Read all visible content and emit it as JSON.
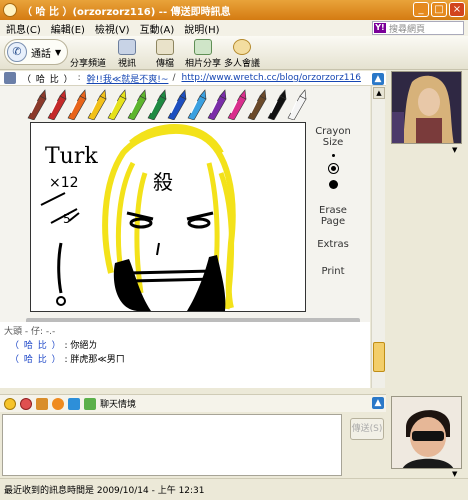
{
  "window": {
    "title": "（ 哈 比 ）(orzorzorz116) -- 傳送即時訊息",
    "min": "_",
    "max": "□",
    "close": "×"
  },
  "menu": {
    "items": [
      "訊息(C)",
      "編輯(E)",
      "檢視(V)",
      "互動(A)",
      "說明(H)"
    ]
  },
  "search": {
    "logo": "Y!",
    "placeholder": "搜尋網頁"
  },
  "toolbar": {
    "call_label": "通話",
    "share_label": "分享頻道",
    "video_label": "視訊",
    "file_label": "傳檔",
    "photo_label": "相片分享",
    "conference_label": "多人會議"
  },
  "address": {
    "name": "（ 哈 比 ）",
    "separator": ":",
    "status_link": "幹!!我≪就是不爽!~",
    "slash": "/",
    "blog_link": "http://www.wretch.cc/blog/orzorzorz116"
  },
  "side_tools": {
    "crayon_size_1": "Crayon",
    "crayon_size_2": "Size",
    "erase_1": "Erase",
    "erase_2": "Page",
    "extras": "Extras",
    "print": "Print"
  },
  "drawing": {
    "text_turk": "Turk",
    "text_x12": "×12",
    "text_kill": "殺",
    "text_5": "5"
  },
  "chat": {
    "header": "大頭 - 仔: -.-",
    "lines": [
      {
        "who": "（ 哈 比 ）",
        "msg": ": 你絕ㄌ"
      },
      {
        "who": "（ 哈 比 ）",
        "msg": ": 胖虎那≪男ㄇ"
      }
    ]
  },
  "emoticons": {
    "label": "聊天情境"
  },
  "input": {
    "send_label": "傳送(S)"
  },
  "status": {
    "text": "最近收到的訊息時間是 2009/10/14 - 上午 12:31"
  },
  "colors": {
    "title_orange": "#d47b12",
    "link_blue": "#1747b3",
    "crayons": [
      "#8b3a2b",
      "#c42a2a",
      "#e8641b",
      "#f2c118",
      "#e6e21a",
      "#5db52e",
      "#1f8a43",
      "#1d4fbf",
      "#3aa0e0",
      "#7a2ea8",
      "#d92f8c",
      "#6b4a2a",
      "#111111",
      "#f4f4f4"
    ]
  }
}
